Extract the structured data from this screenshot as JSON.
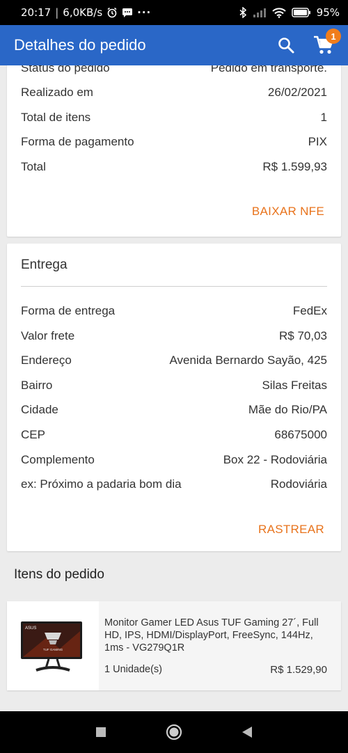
{
  "status_bar": {
    "time": "20:17",
    "net_speed": "6,0KB/s",
    "battery": "95%"
  },
  "app_bar": {
    "title": "Detalhes do pedido",
    "cart_count": "1"
  },
  "order_card": {
    "rows": [
      {
        "label": "Status do pedido",
        "value": "Pedido em transporte."
      },
      {
        "label": "Realizado em",
        "value": "26/02/2021"
      },
      {
        "label": "Total de itens",
        "value": "1"
      },
      {
        "label": "Forma de pagamento",
        "value": "PIX"
      },
      {
        "label": "Total",
        "value": "R$ 1.599,93"
      }
    ],
    "action": "BAIXAR NFE"
  },
  "delivery_card": {
    "title": "Entrega",
    "rows": [
      {
        "label": "Forma de entrega",
        "value": "FedEx"
      },
      {
        "label": "Valor frete",
        "value": "R$ 70,03"
      },
      {
        "label": "Endereço",
        "value": "Avenida Bernardo Sayão, 425"
      },
      {
        "label": "Bairro",
        "value": "Silas Freitas"
      },
      {
        "label": "Cidade",
        "value": "Mãe do Rio/PA"
      },
      {
        "label": "CEP",
        "value": "68675000"
      },
      {
        "label": "Complemento",
        "value": "Box 22 - Rodoviária"
      },
      {
        "label": "ex: Próximo a padaria bom dia",
        "value": "Rodoviária"
      }
    ],
    "action": "RASTREAR"
  },
  "items": {
    "title": "Itens do pedido",
    "list": [
      {
        "name": "Monitor Gamer LED Asus TUF Gaming 27´, Full HD, IPS, HDMI/DisplayPort, FreeSync, 144Hz, 1ms - VG279Q1R",
        "quantity": "1 Unidade(s)",
        "price": "R$ 1.529,90",
        "image_brand": "ASUS",
        "image_caption": "TUF GAMING"
      }
    ]
  },
  "colors": {
    "primary": "#2a67c7",
    "accent": "#e8731c",
    "badge": "#f07d1c"
  }
}
